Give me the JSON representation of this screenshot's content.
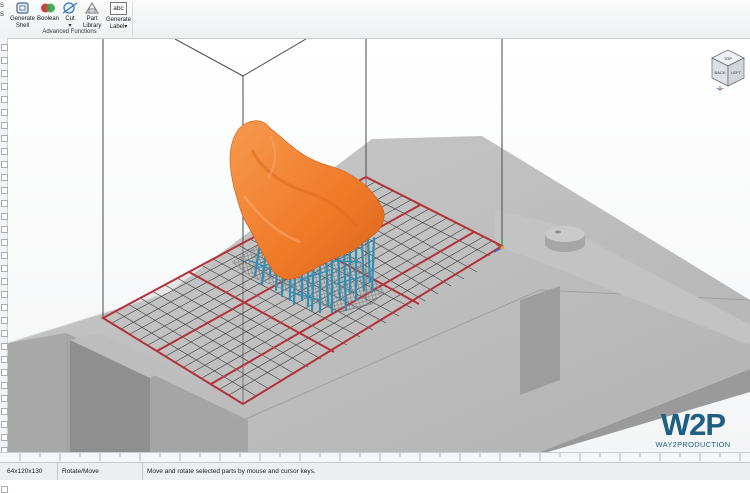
{
  "ribbon": {
    "buttons": [
      {
        "label": "Generate\nShell",
        "icon": "generate-shell-icon"
      },
      {
        "label": "Boolean",
        "icon": "boolean-icon"
      },
      {
        "label": "Cut\n▾",
        "icon": "cut-icon"
      },
      {
        "label": "Part\nLibrary",
        "icon": "part-library-icon"
      },
      {
        "label": "Generate\nLabel▾",
        "icon": "generate-label-icon"
      }
    ],
    "group_label": "Advanced Functions",
    "label_icon_text": "abc"
  },
  "viewcube": {
    "faces": [
      "TOP",
      "BACK",
      "LEFT"
    ]
  },
  "colors": {
    "part": "#f07f2e",
    "supports": "#2f8fb3",
    "grid_border": "#b3323a",
    "plate": "#b9b9b9"
  },
  "logo": {
    "mark": "W2P",
    "tagline": "WAY2PRODUCTION"
  },
  "status": {
    "dimensions": "64x120x130",
    "mode": "Rotate/Move",
    "hint": "Move and rotate selected parts by mouse and cursor keys."
  }
}
